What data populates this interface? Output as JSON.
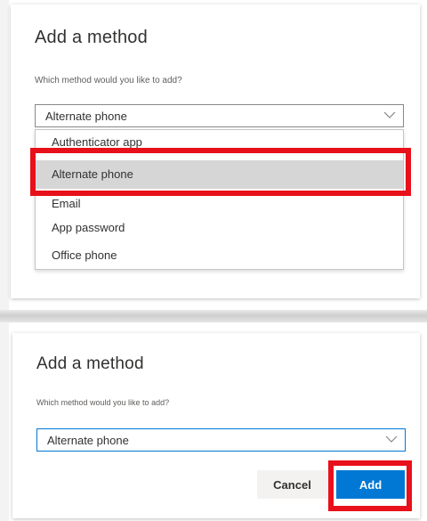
{
  "top_dialog": {
    "title": "Add a method",
    "question": "Which method would you like to add?",
    "select_value": "Alternate phone",
    "options": [
      {
        "label": "Authenticator app"
      },
      {
        "label": "Alternate phone",
        "selected": true
      },
      {
        "label": "Email"
      },
      {
        "label": "App password"
      },
      {
        "label": "Office phone"
      }
    ]
  },
  "bottom_dialog": {
    "title": "Add a method",
    "question": "Which method would you like to add?",
    "select_value": "Alternate phone",
    "cancel_label": "Cancel",
    "add_label": "Add"
  },
  "colors": {
    "highlight": "#e8101a",
    "primary_button": "#0078d4",
    "selected_option": "#d6d6d6"
  },
  "icons": {
    "dropdown": "chevron-down-icon"
  }
}
